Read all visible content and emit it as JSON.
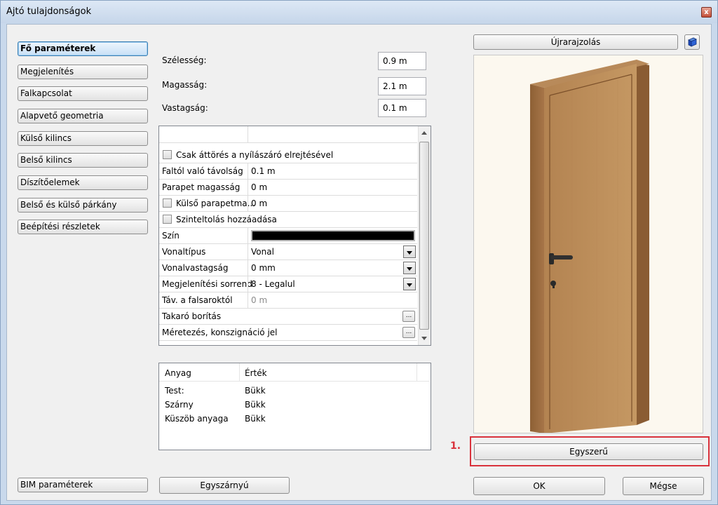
{
  "window": {
    "title": "Ajtó tulajdonságok",
    "close_glyph": "x"
  },
  "nav": [
    {
      "label": "Fő paraméterek",
      "active": true
    },
    {
      "label": "Megjelenítés"
    },
    {
      "label": "Falkapcsolat"
    },
    {
      "label": "Alapvető geometria"
    },
    {
      "label": "Külső kilincs"
    },
    {
      "label": "Belső kilincs"
    },
    {
      "label": "Díszítőelemek"
    },
    {
      "label": "Belső és külső párkány"
    },
    {
      "label": "Beépítési részletek"
    }
  ],
  "dims": {
    "width_label": "Szélesség:",
    "width_value": "0.9 m",
    "height_label": "Magasság:",
    "height_value": "2.1 m",
    "thickness_label": "Vastagság:",
    "thickness_value": "0.1 m"
  },
  "props": {
    "row1": "Csak áttörés a nyílászáró elrejtésével",
    "row2_name": "Faltól való távolság",
    "row2_value": "0.1 m",
    "row3_name": "Parapet magasság",
    "row3_value": "0 m",
    "row4_name": "Külső parapetma...",
    "row4_value": "0 m",
    "row5": "Szinteltolás hozzáadása",
    "row6_name": "Szín",
    "color": "#000000",
    "row7_name": "Vonaltípus",
    "row7_value": "Vonal",
    "row8_name": "Vonalvastagság",
    "row8_value": "0 mm",
    "row9_name": "Megjelenítési sorrend",
    "row9_value": "8 - Legalul",
    "row10_name": "Táv. a falsaroktól",
    "row10_value": "0 m",
    "row11_name": "Takaró borítás",
    "row12_name": "Méretezés, konszignáció jel",
    "ellipsis": "..."
  },
  "materials": {
    "col1": "Anyag",
    "col2": "Érték",
    "rows": [
      {
        "name": "Test:",
        "value": "Bükk"
      },
      {
        "name": "Szárny",
        "value": "Bükk"
      },
      {
        "name": "Küszöb anyaga",
        "value": "Bükk"
      }
    ]
  },
  "preview": {
    "redraw_label": "Újrarajzolás",
    "simple_label": "Egyszerű",
    "note": "1."
  },
  "footer": {
    "bim_label": "BIM paraméterek",
    "type_label": "Egyszárnyú",
    "ok_label": "OK",
    "cancel_label": "Mégse"
  }
}
